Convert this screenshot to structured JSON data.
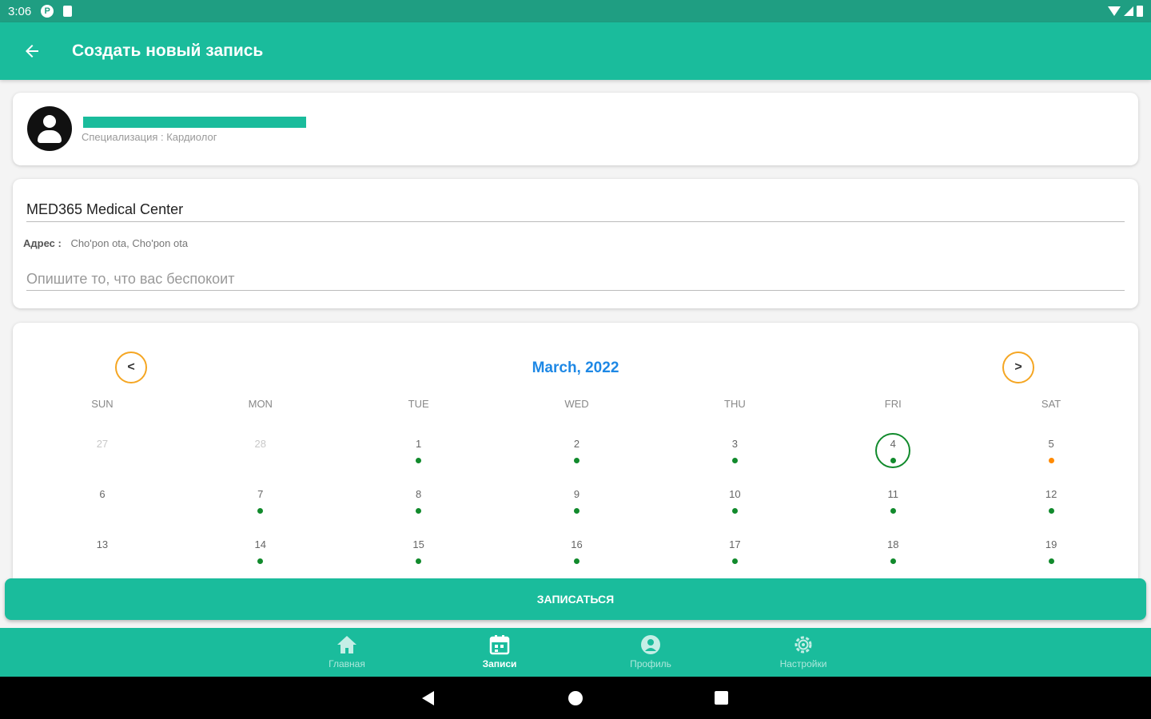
{
  "status_bar": {
    "time": "3:06"
  },
  "appbar": {
    "title": "Создать новый запись"
  },
  "doctor": {
    "specialization": "Специализация : Кардиолог"
  },
  "clinic": {
    "name": "MED365 Medical Center",
    "address_label": "Адрес :",
    "address_value": "Cho'pon ota, Cho'pon ota",
    "complaint_placeholder": "Опишите то, что вас беспокоит"
  },
  "calendar": {
    "prev_label": "<",
    "next_label": ">",
    "month_title": "March, 2022",
    "weekdays": [
      "SUN",
      "MON",
      "TUE",
      "WED",
      "THU",
      "FRI",
      "SAT"
    ],
    "weeks": [
      [
        {
          "num": "27",
          "other": true,
          "dot": "none"
        },
        {
          "num": "28",
          "other": true,
          "dot": "none"
        },
        {
          "num": "1",
          "dot": "green"
        },
        {
          "num": "2",
          "dot": "green"
        },
        {
          "num": "3",
          "dot": "green"
        },
        {
          "num": "4",
          "dot": "green",
          "selected": true
        },
        {
          "num": "5",
          "dot": "orange"
        }
      ],
      [
        {
          "num": "6",
          "dot": "none"
        },
        {
          "num": "7",
          "dot": "green"
        },
        {
          "num": "8",
          "dot": "green"
        },
        {
          "num": "9",
          "dot": "green"
        },
        {
          "num": "10",
          "dot": "green"
        },
        {
          "num": "11",
          "dot": "green"
        },
        {
          "num": "12",
          "dot": "green"
        }
      ],
      [
        {
          "num": "13",
          "dot": "none"
        },
        {
          "num": "14",
          "dot": "green"
        },
        {
          "num": "15",
          "dot": "green"
        },
        {
          "num": "16",
          "dot": "green"
        },
        {
          "num": "17",
          "dot": "green"
        },
        {
          "num": "18",
          "dot": "green"
        },
        {
          "num": "19",
          "dot": "green"
        }
      ]
    ]
  },
  "submit": {
    "label": "ЗАПИСАТЬСЯ"
  },
  "bottom_nav": [
    {
      "key": "home",
      "label": "Главная",
      "icon": "home-icon"
    },
    {
      "key": "records",
      "label": "Записи",
      "icon": "calendar-icon",
      "active": true
    },
    {
      "key": "profile",
      "label": "Профиль",
      "icon": "profile-icon"
    },
    {
      "key": "settings",
      "label": "Настройки",
      "icon": "gear-icon"
    }
  ],
  "colors": {
    "primary": "#1abc9c",
    "status_bar": "#1f9e82",
    "month_title": "#1e88e5",
    "nav_ring": "#f5a623",
    "dot_green": "#118a2c",
    "dot_orange": "#ff8a00"
  }
}
